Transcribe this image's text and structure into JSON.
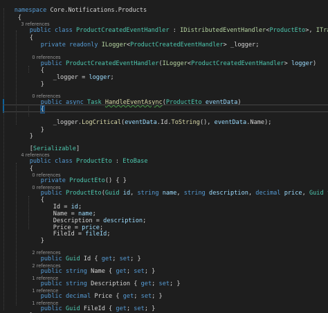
{
  "code": {
    "namespace_kw": "namespace",
    "namespace_name": " Core.Notifications.Products",
    "references": {
      "three": "3 references",
      "zero": "0 references",
      "four": "4 references",
      "two": "2 references",
      "one": "1 reference"
    },
    "kw": {
      "public": "public",
      "class": "class",
      "private": "private",
      "readonly": "readonly",
      "async": "async",
      "string": "string",
      "decimal": "decimal",
      "get": "get",
      "set": "set"
    },
    "handler_class": "ProductCreatedEventHandler",
    "interface1": "IDistributedEventHandler",
    "interface2": "ITransientDependency",
    "eto_class": "ProductEto",
    "eto_base": "EtoBase",
    "ilogger": "ILogger",
    "guid": "Guid",
    "task": "Task",
    "field_logger": "_logger",
    "param_logger": "logger",
    "method_handle": "HandleEventAsync",
    "param_eventdata": "eventData",
    "method_logcritical": "LogCritical",
    "method_tostring": "ToString",
    "prop_id": "Id",
    "prop_name": "Name",
    "prop_description": "Description",
    "prop_price": "Price",
    "prop_fileid": "FileId",
    "param_id": "id",
    "param_name": "name",
    "param_description": "description",
    "param_price": "price",
    "param_fileid": "fileId",
    "attribute": "Serializable",
    "sym": {
      "open_brace": "{",
      "close_brace": "}",
      "empty_ctor": "() { }",
      "accessor_tail": "; } ",
      "accessor_tail_last": "; }"
    }
  }
}
